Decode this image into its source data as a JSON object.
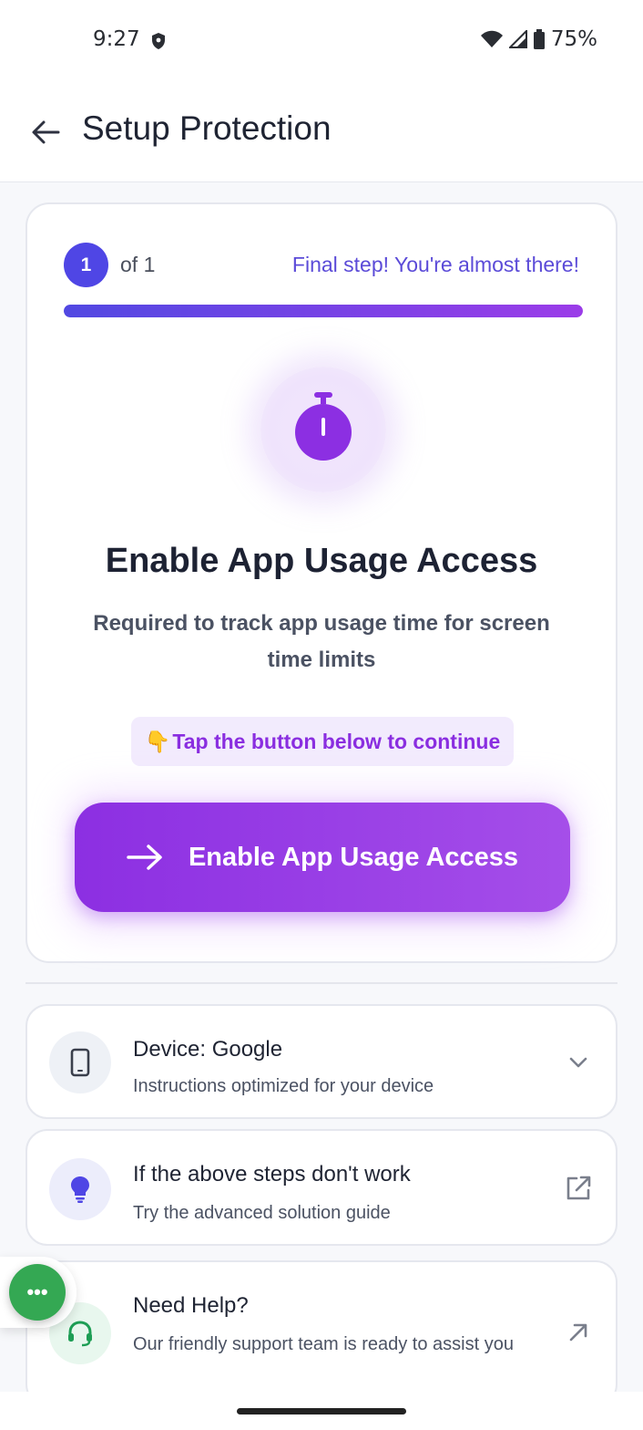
{
  "status_bar": {
    "time": "9:27",
    "battery": "75%",
    "icons": [
      "shield-icon",
      "wifi-icon",
      "signal-icon",
      "battery-icon"
    ]
  },
  "app_bar": {
    "title": "Setup Protection",
    "back_icon": "arrow-left-icon"
  },
  "step": {
    "current": "1",
    "of_label": "of 1",
    "message": "Final step! You're almost there!",
    "progress": 1.0
  },
  "main": {
    "hero_icon": "stopwatch-icon",
    "title": "Enable App Usage Access",
    "subtitle": "Required to track app usage time for screen time limits",
    "hint_emoji": "👇",
    "hint_text": "Tap the button below to continue",
    "cta_label": "Enable App Usage Access",
    "cta_icon": "arrow-right-icon"
  },
  "rows": [
    {
      "icon": "phone-icon",
      "title": "Device: Google",
      "subtitle": "Instructions optimized for your device",
      "tail_icon": "chevron-down-icon"
    },
    {
      "icon": "lightbulb-icon",
      "title": "If the above steps don't work",
      "subtitle": "Try the advanced solution guide",
      "tail_icon": "external-link-icon"
    },
    {
      "icon": "headset-icon",
      "title": "Need Help?",
      "subtitle": "Our friendly support team is ready to assist you",
      "tail_icon": "arrow-up-right-icon"
    }
  ],
  "fab": {
    "label": "•••",
    "icon": "more-dots-icon"
  },
  "colors": {
    "primary": "#4f46e5",
    "accent": "#8c2fe2",
    "hint_bg": "#f2ebfd",
    "fab_green": "#34a853"
  }
}
